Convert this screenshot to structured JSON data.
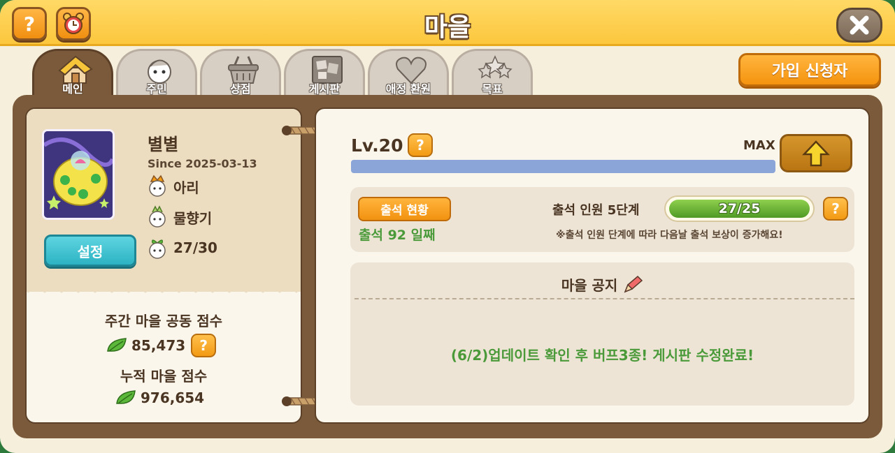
{
  "header": {
    "title": "마을",
    "help_label": "?"
  },
  "tabs": [
    {
      "label": "메인",
      "icon": "house-icon",
      "active": true
    },
    {
      "label": "주민",
      "icon": "resident-icon",
      "active": false
    },
    {
      "label": "상점",
      "icon": "basket-icon",
      "active": false
    },
    {
      "label": "게시판",
      "icon": "board-icon",
      "active": false
    },
    {
      "label": "애정 환원",
      "icon": "heart-icon",
      "active": false
    },
    {
      "label": "목표",
      "icon": "stars-icon",
      "active": false
    }
  ],
  "join_button": "가입 신청자",
  "village": {
    "name": "별별",
    "since": "Since 2025-03-13",
    "leader": "아리",
    "sub_leader": "물향기",
    "members": "27/30",
    "settings_button": "설정"
  },
  "scores": {
    "weekly_label": "주간 마을 공동 점수",
    "weekly_value": "85,473",
    "total_label": "누적 마을 점수",
    "total_value": "976,654"
  },
  "level": {
    "label": "Lv.20",
    "max_label": "MAX",
    "progress": 1.0
  },
  "attendance": {
    "button": "출석 현황",
    "days": "출석 92 일째",
    "stage": "출석 인원 5단계",
    "count": "27/25",
    "fill": 1.0,
    "note": "※출석 인원 단계에 따라 다음날 출석 보상이 증가해요!"
  },
  "notice": {
    "title": "마을 공지",
    "text": "(6/2)업데이트 확인 후 버프3종! 게시판 수정완료!"
  },
  "colors": {
    "topbar": "#fcc73d",
    "board": "#7a5a3a",
    "accent_orange": "#f5930f",
    "teal": "#2cb3c3",
    "green_text": "#4b9a3a",
    "level_bar": "#8ca5d8"
  }
}
